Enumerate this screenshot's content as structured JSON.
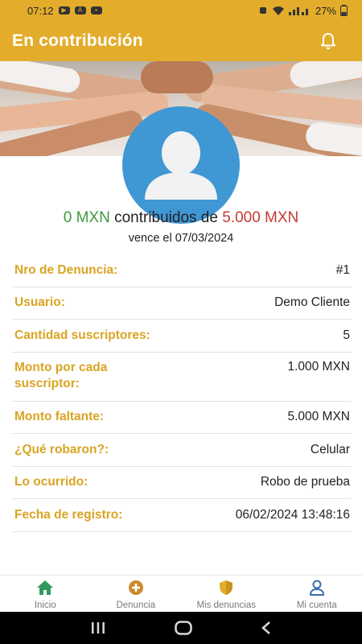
{
  "status_bar": {
    "time": "07:12",
    "battery": "27%"
  },
  "app_bar": {
    "title": "En contribución",
    "bell_icon": "bell-icon"
  },
  "contribution": {
    "contributed": "0 MXN",
    "middle_text": "contribuidos de",
    "goal": "5.000 MXN",
    "due": "vence el 07/03/2024"
  },
  "details": [
    {
      "label": "Nro de Denuncia:",
      "value": "#1"
    },
    {
      "label": "Usuario:",
      "value": "Demo Cliente"
    },
    {
      "label": "Cantidad suscriptores:",
      "value": "5"
    },
    {
      "label": "Monto por cada suscriptor:",
      "value": "1.000 MXN"
    },
    {
      "label": "Monto faltante:",
      "value": "5.000 MXN"
    },
    {
      "label": "¿Qué robaron?:",
      "value": "Celular"
    },
    {
      "label": "Lo ocurrido:",
      "value": "Robo de prueba"
    },
    {
      "label": "Fecha de registro:",
      "value": "06/02/2024 13:48:16"
    }
  ],
  "bottom_nav": [
    {
      "label": "Inicio",
      "icon": "home-icon"
    },
    {
      "label": "Denuncia",
      "icon": "plus-circle-icon"
    },
    {
      "label": "Mis denuncias",
      "icon": "shield-icon"
    },
    {
      "label": "Mi cuenta",
      "icon": "user-icon"
    }
  ],
  "colors": {
    "accent": "#e3ad2b",
    "label": "#d9a422",
    "green": "#3d9a3d",
    "red": "#c33a35",
    "avatar": "#3f97d3"
  }
}
